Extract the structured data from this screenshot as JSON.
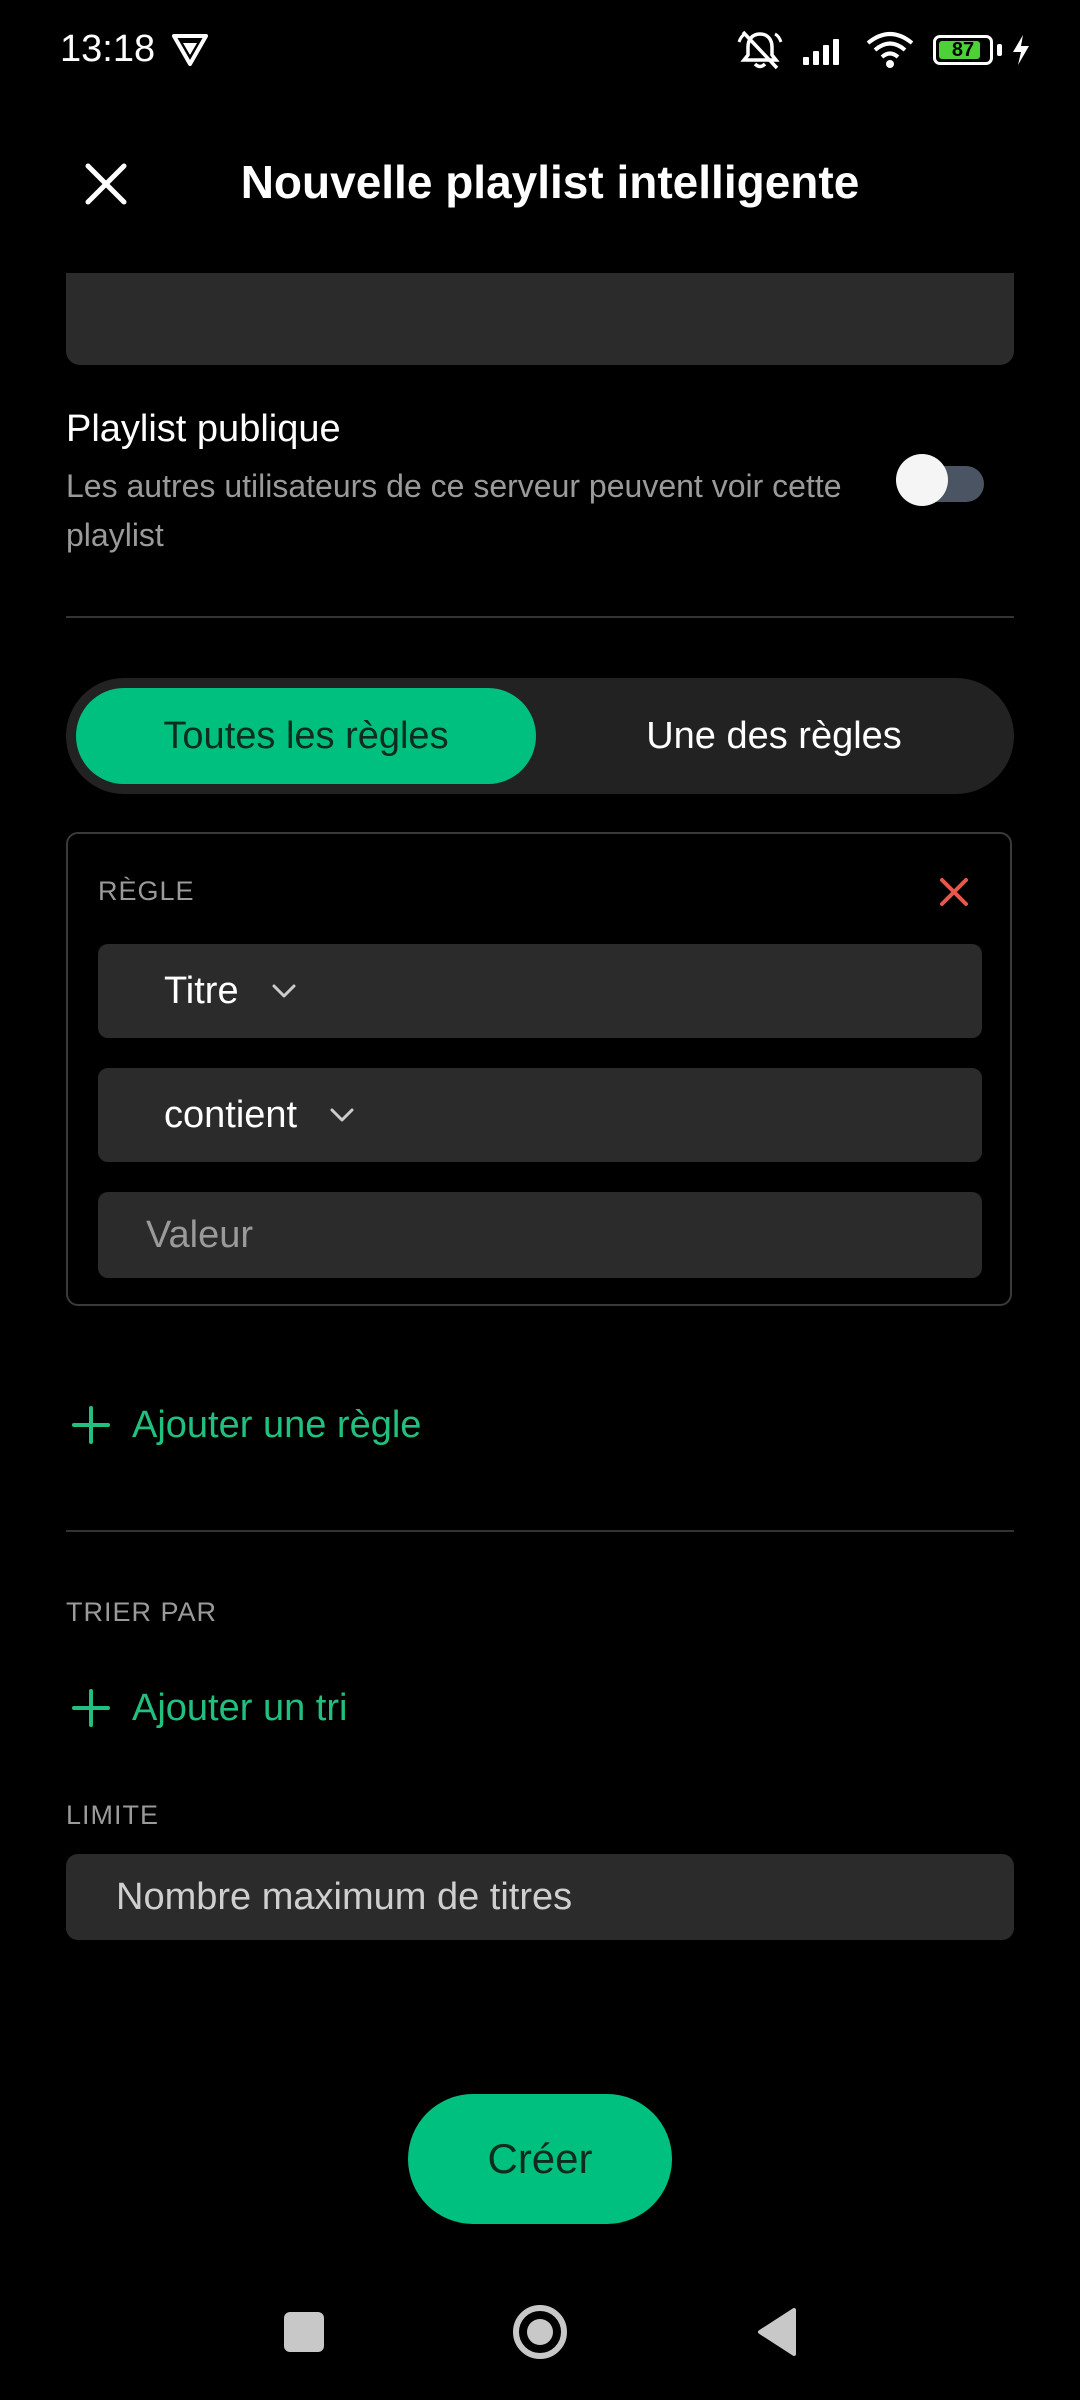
{
  "status_bar": {
    "time": "13:18",
    "battery": "87",
    "battery_level": 0.87,
    "icons": [
      "vpn-icon",
      "dnd-mute-icon",
      "signal-icon",
      "wifi-icon",
      "battery-icon",
      "charging-icon"
    ]
  },
  "header": {
    "title": "Nouvelle playlist intelligente",
    "close_icon": "close-icon"
  },
  "public_playlist": {
    "title": "Playlist publique",
    "subtitle": "Les autres utilisateurs de ce serveur peuvent voir cette playlist",
    "enabled": false
  },
  "match_mode": {
    "all_label": "Toutes les règles",
    "any_label": "Une des règles",
    "selected": "all"
  },
  "rule": {
    "label": "RÈGLE",
    "field": "Titre",
    "operator": "contient",
    "value_placeholder": "Valeur",
    "value": ""
  },
  "add_rule_label": "Ajouter une règle",
  "sort": {
    "label": "TRIER PAR",
    "add_label": "Ajouter un tri"
  },
  "limit": {
    "label": "LIMITE",
    "placeholder": "Nombre maximum de titres",
    "value": ""
  },
  "create_label": "Créer",
  "colors": {
    "accent": "#00c07f",
    "accent_text": "#22c07f",
    "remove": "#e8574b",
    "background": "#000000",
    "field": "#2b2b2b"
  },
  "nav_bar": [
    "recents-icon",
    "home-icon",
    "back-icon"
  ]
}
